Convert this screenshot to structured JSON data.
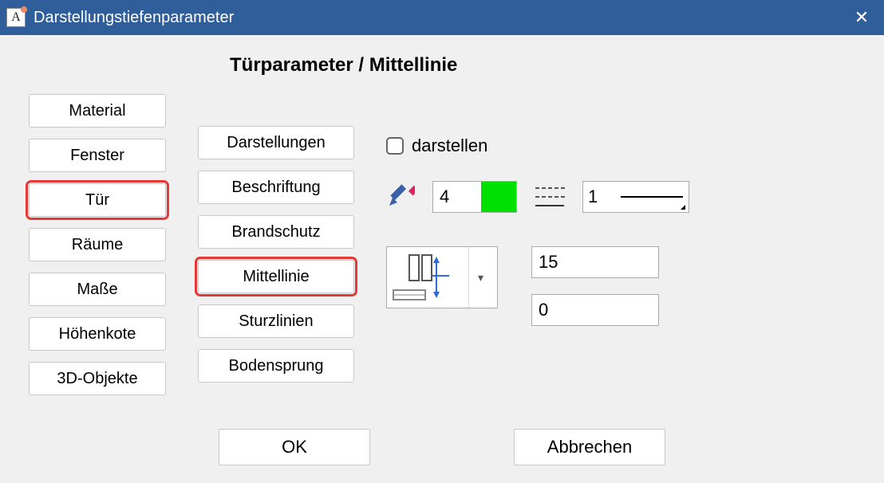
{
  "window": {
    "title": "Darstellungstiefenparameter",
    "app_icon_letter": "A"
  },
  "heading": "Türparameter / Mittellinie",
  "left_categories": [
    {
      "label": "Material",
      "selected": false
    },
    {
      "label": "Fenster",
      "selected": false
    },
    {
      "label": "Tür",
      "selected": true
    },
    {
      "label": "Räume",
      "selected": false
    },
    {
      "label": "Maße",
      "selected": false
    },
    {
      "label": "Höhenkote",
      "selected": false
    },
    {
      "label": "3D-Objekte",
      "selected": false
    }
  ],
  "sub_categories": [
    {
      "label": "Darstellungen",
      "selected": false
    },
    {
      "label": "Beschriftung",
      "selected": false
    },
    {
      "label": "Brandschutz",
      "selected": false
    },
    {
      "label": "Mittellinie",
      "selected": true
    },
    {
      "label": "Sturzlinien",
      "selected": false
    },
    {
      "label": "Bodensprung",
      "selected": false
    }
  ],
  "display": {
    "checkbox_label": "darstellen",
    "checkbox_checked": false,
    "pen_value": "4",
    "pen_color": "#00e000",
    "linetype_value": "1"
  },
  "geometry": {
    "value1": "15",
    "value2": "0"
  },
  "footer": {
    "ok": "OK",
    "cancel": "Abbrechen"
  }
}
